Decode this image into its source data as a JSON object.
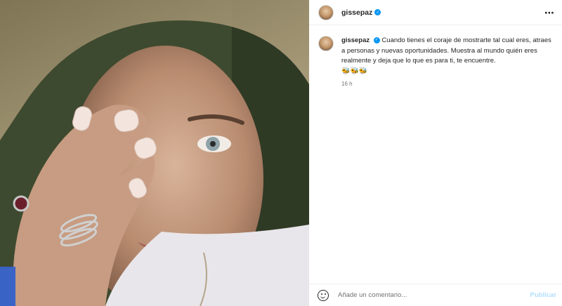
{
  "post": {
    "username": "gissepaz",
    "verified": true,
    "more_icon": "more-horizontal-icon",
    "caption": "Cuando tienes el coraje de mostrarte tal cual eres, atraes a personas y nuevas oportunidades. Muestra al mundo quién eres realmente y deja que lo que es para ti, te encuentre.",
    "emojis": "🐝🐝🐝",
    "timestamp": "16 h"
  },
  "comment": {
    "placeholder": "Añade un comentario...",
    "publish_label": "Publicar",
    "emoji_icon": "smiley-icon"
  },
  "colors": {
    "accent": "#0095f6",
    "publish_disabled": "#b2dffc",
    "text": "#262626",
    "muted": "#737373"
  }
}
